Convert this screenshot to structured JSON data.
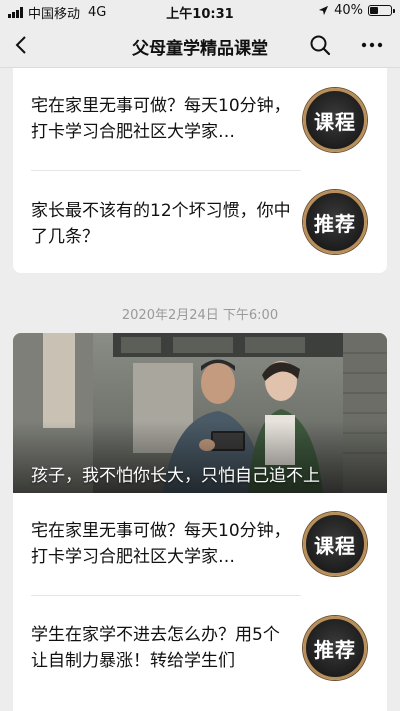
{
  "status_bar": {
    "carrier": "中国移动",
    "network": "4G",
    "time": "上午10:31",
    "battery": "40%",
    "battery_level": 0.4
  },
  "nav": {
    "title": "父母童学精品课堂",
    "back_icon": "back-chevron-icon",
    "search_icon": "search-icon",
    "more_icon": "more-dots-icon"
  },
  "feed": {
    "group1": {
      "items": [
        {
          "text": "宅在家里无事可做？每天10分钟，打卡学习合肥社区大学家…",
          "badge": "课程"
        },
        {
          "text": "家长最不该有的12个坏习惯，你中了几条？",
          "badge": "推荐"
        }
      ]
    },
    "timestamp": "2020年2月24日 下午6:00",
    "group2": {
      "cover_caption": "孩子，我不怕你长大，只怕自己追不上",
      "items": [
        {
          "text": "宅在家里无事可做？每天10分钟，打卡学习合肥社区大学家…",
          "badge": "课程"
        },
        {
          "text": "学生在家学不进去怎么办？用5个让自制力暴涨！转给学生们",
          "badge": "推荐"
        }
      ]
    }
  },
  "colors": {
    "background": "#ededed",
    "card": "#ffffff",
    "badge_ring": "#b88f5a",
    "timestamp": "#9a9a9a"
  }
}
